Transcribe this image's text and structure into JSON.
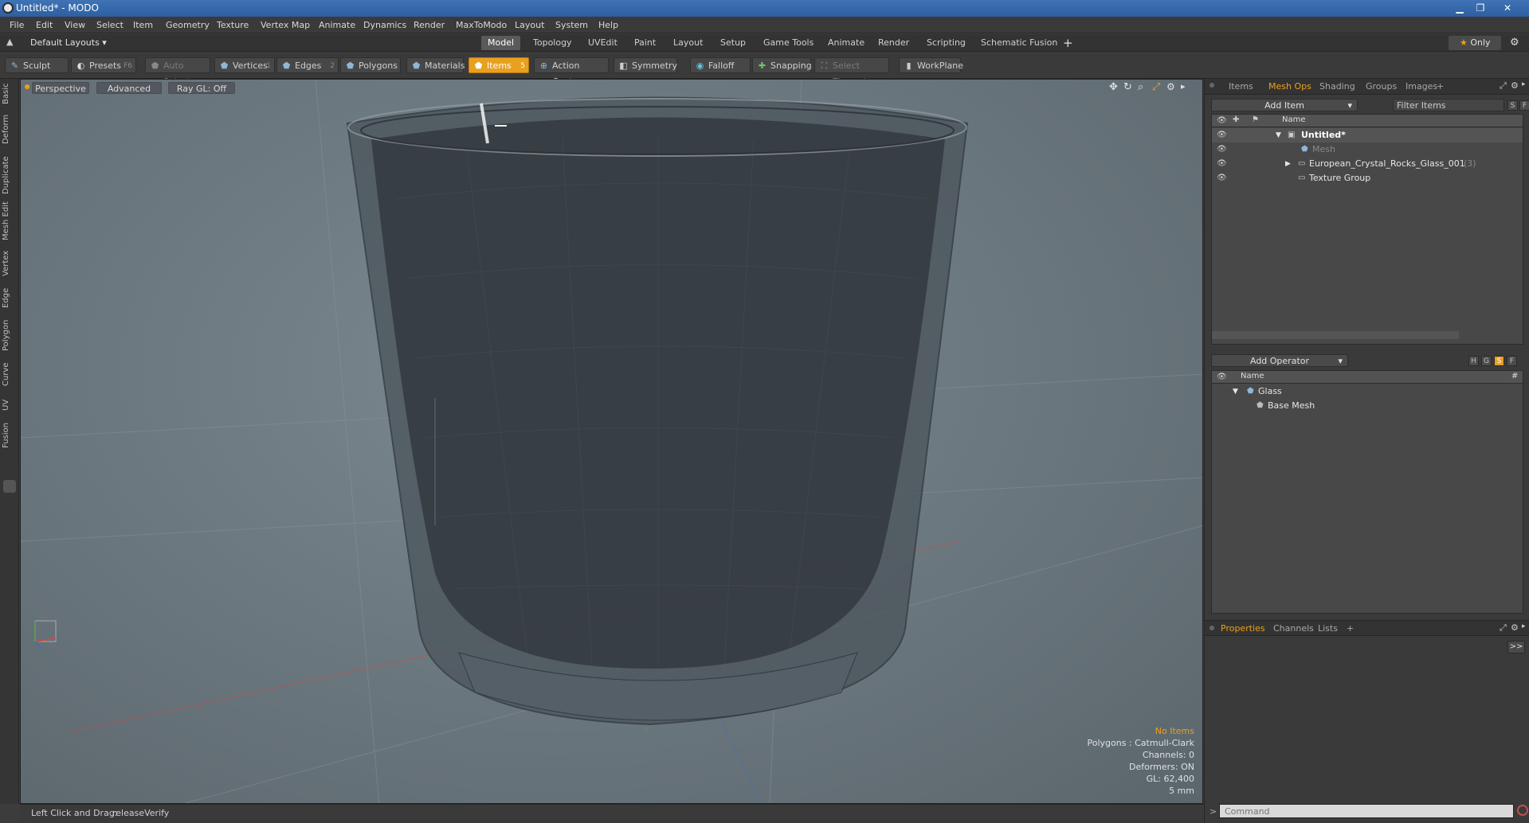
{
  "window": {
    "title": "Untitled* - MODO",
    "min": "▁",
    "restore": "❐",
    "close": "✕"
  },
  "menu": [
    "File",
    "Edit",
    "View",
    "Select",
    "Item",
    "Geometry",
    "Texture",
    "Vertex Map",
    "Animate",
    "Dynamics",
    "Render",
    "MaxToModo",
    "Layout",
    "System",
    "Help"
  ],
  "layouts": {
    "current": "Default Layouts ▾",
    "tabs": [
      "Model",
      "Topology",
      "UVEdit",
      "Paint",
      "Layout",
      "Setup",
      "Game Tools",
      "Animate",
      "Render",
      "Scripting",
      "Schematic Fusion"
    ],
    "active_tab": "Model",
    "add": "+",
    "only": "Only"
  },
  "toolbar": {
    "sculpt": "Sculpt",
    "presets": "Presets",
    "presets_key": "F6",
    "auto_select": "Auto Select",
    "vertices": "Vertices",
    "vertices_key": "1",
    "edges": "Edges",
    "edges_key": "2",
    "polygons": "Polygons",
    "materials": "Materials",
    "items": "Items",
    "items_key": "5",
    "action_center": "Action Center",
    "symmetry": "Symmetry",
    "falloff": "Falloff",
    "snapping": "Snapping",
    "select_through": "Select Through",
    "workplane": "WorkPlane"
  },
  "left_tabs": [
    "Basic",
    "Deform",
    "Duplicate",
    "Mesh Edit",
    "Vertex",
    "Edge",
    "Polygon",
    "Curve",
    "UV",
    "Fusion"
  ],
  "viewport": {
    "perspective": "Perspective",
    "advanced": "Advanced",
    "raygl": "Ray GL: Off",
    "stats": {
      "no_items": "No Items",
      "polygons": "Polygons : Catmull-Clark",
      "channels": "Channels: 0",
      "deformers": "Deformers: ON",
      "gl": "GL: 62,400",
      "scale": "5 mm"
    }
  },
  "status": {
    "hint_label": "Left Click and Drag:",
    "hint_value": "releaseVerify"
  },
  "item_panel": {
    "tabs": [
      "Items",
      "Mesh Ops",
      "Shading",
      "Groups",
      "Images",
      "+"
    ],
    "active_tab": "Mesh Ops",
    "add_item": "Add Item",
    "filter": "Filter Items",
    "s": "S",
    "f": "F",
    "header_name": "Name",
    "rows": [
      {
        "label": "Untitled*"
      },
      {
        "label": "Mesh"
      },
      {
        "label": "European_Crystal_Rocks_Glass_001",
        "count": "(3)"
      },
      {
        "label": "Texture Group"
      }
    ]
  },
  "operator_panel": {
    "add_operator": "Add Operator",
    "h": "H",
    "g": "G",
    "s": "S",
    "f": "F",
    "header_name": "Name",
    "header_hash": "#",
    "rows": [
      {
        "label": "Glass"
      },
      {
        "label": "Base Mesh"
      }
    ]
  },
  "props_panel": {
    "tabs": [
      "Properties",
      "Channels",
      "Lists",
      "+"
    ],
    "active_tab": "Properties",
    "expand": ">>",
    "command_placeholder": "Command"
  },
  "colors": {
    "accent": "#e8a020",
    "title_bar": "#3f74b6",
    "viewport": "#6a767d"
  }
}
